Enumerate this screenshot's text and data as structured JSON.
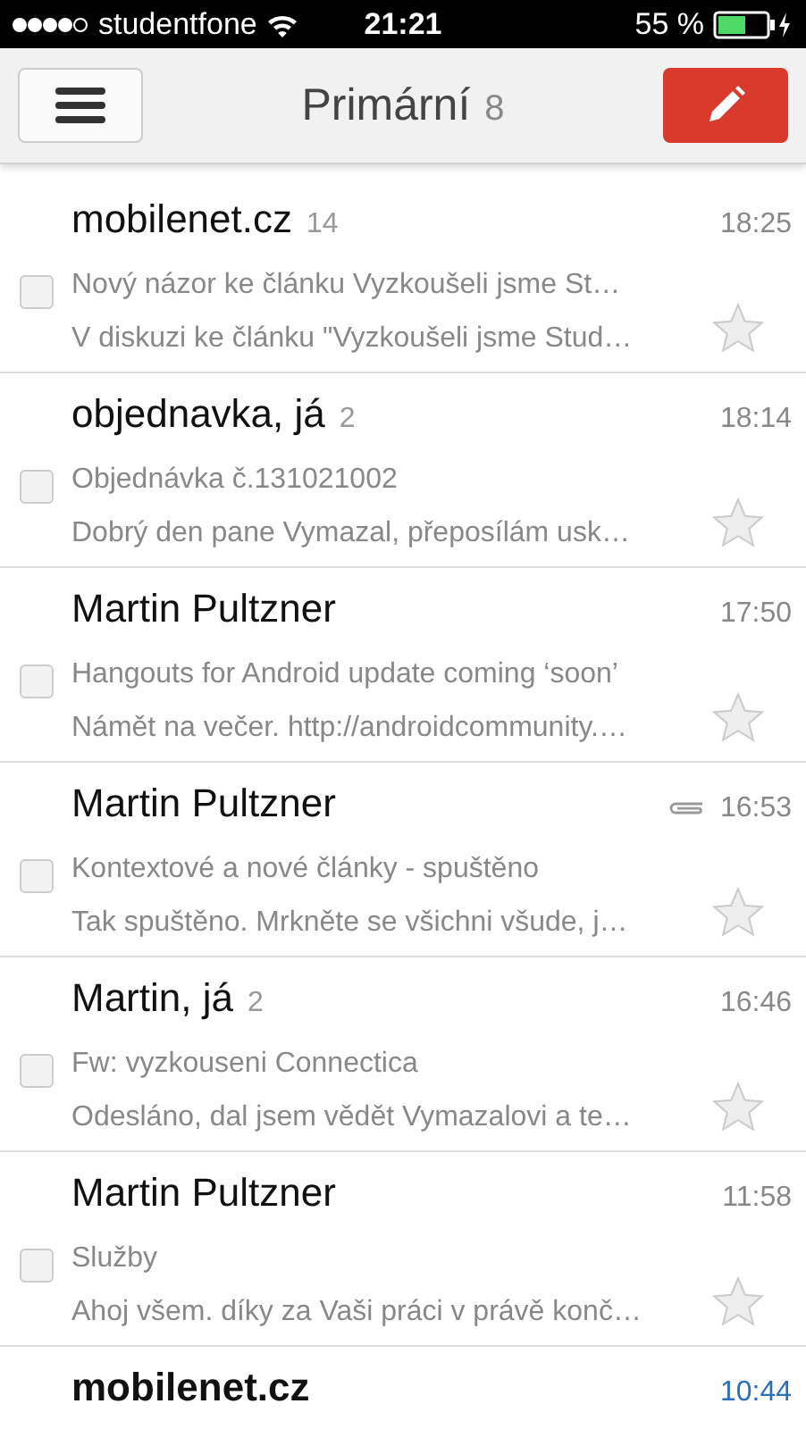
{
  "status_bar": {
    "carrier": "studentfone",
    "time": "21:21",
    "battery": "55 %"
  },
  "header": {
    "title": "Primární",
    "count": "8"
  },
  "emails": [
    {
      "sender": "mobilenet.cz",
      "count": "14",
      "time": "18:25",
      "attachment": false,
      "unread": false,
      "checked": false,
      "starred": false,
      "subject": "Nový názor ke článku Vyzkoušeli jsme St…",
      "snippet": "V diskuzi ke článku \"Vyzkoušeli jsme Stud…"
    },
    {
      "sender": "objednavka, já",
      "count": "2",
      "time": "18:14",
      "attachment": false,
      "unread": false,
      "checked": false,
      "starred": false,
      "subject": "Objednávka č.131021002",
      "snippet": "Dobrý den pane Vymazal, přeposílám usk…"
    },
    {
      "sender": "Martin Pultzner",
      "time": "17:50",
      "attachment": false,
      "unread": false,
      "checked": false,
      "starred": false,
      "subject": "Hangouts for Android update coming ‘soon’",
      "snippet": "Námět na večer. http://androidcommunity.…"
    },
    {
      "sender": "Martin Pultzner",
      "time": "16:53",
      "attachment": true,
      "unread": false,
      "checked": false,
      "starred": false,
      "subject": "Kontextové a nové články - spuštěno",
      "snippet": "Tak spuštěno. Mrkněte se všichni všude, j…"
    },
    {
      "sender": "Martin, já",
      "count": "2",
      "time": "16:46",
      "attachment": false,
      "unread": false,
      "checked": false,
      "starred": false,
      "subject": "Fw: vyzkouseni Connectica",
      "snippet": "Odesláno, dal jsem vědět Vymazalovi a te…"
    },
    {
      "sender": "Martin Pultzner",
      "time": "11:58",
      "attachment": false,
      "unread": false,
      "checked": false,
      "starred": false,
      "subject": "Služby",
      "snippet": "Ahoj všem. díky za Vaši práci v právě konč…"
    },
    {
      "sender": "mobilenet.cz",
      "time": "10:44",
      "attachment": false,
      "unread": true
    }
  ]
}
